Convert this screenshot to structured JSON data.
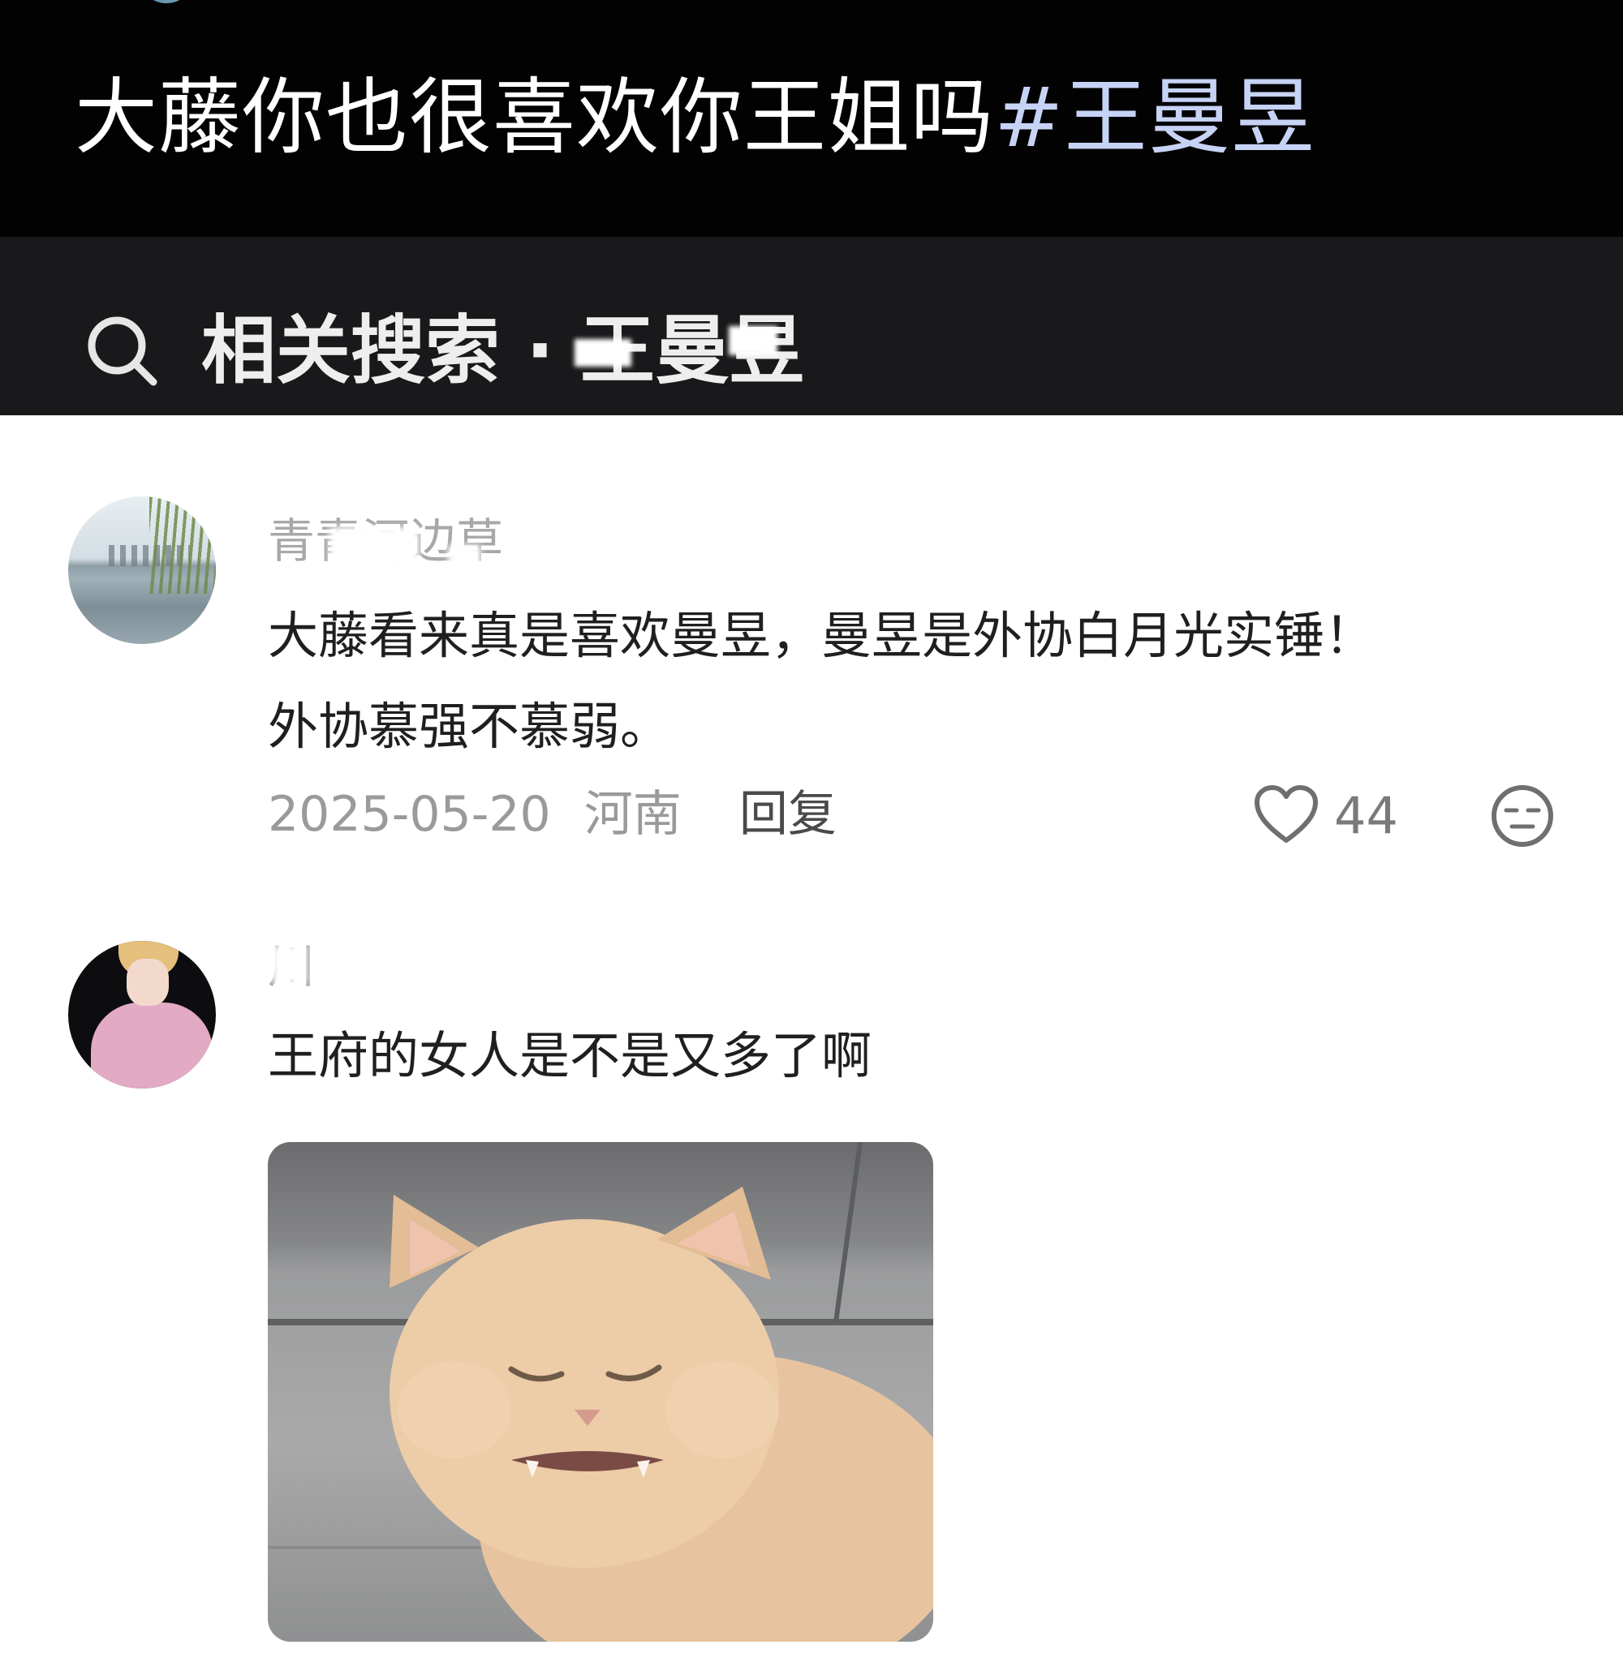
{
  "caption": {
    "text": "大藤你也很喜欢你王姐吗",
    "hashtag": "#王曼昱"
  },
  "related_search": {
    "label": "相关搜索 · ",
    "term": "王曼昱"
  },
  "comments": [
    {
      "username": "青青河边草",
      "text_line1": "大藤看来真是喜欢曼昱，曼昱是外协白月光实锤！",
      "text_line2": "外协慕强不慕弱。",
      "date": "2025-05-20",
      "location": "河南",
      "reply_label": "回复",
      "likes": "44"
    },
    {
      "username": "川",
      "text": "王府的女人是不是又多了啊"
    }
  ],
  "icons": {
    "search": "search-icon",
    "like": "heart-outline-icon",
    "dislike": "meh-face-icon"
  },
  "colors": {
    "caption_bg": "#020203",
    "search_bg": "#19191b",
    "hashtag": "#c7d3f5",
    "meta_gray": "#9a9a9a"
  }
}
